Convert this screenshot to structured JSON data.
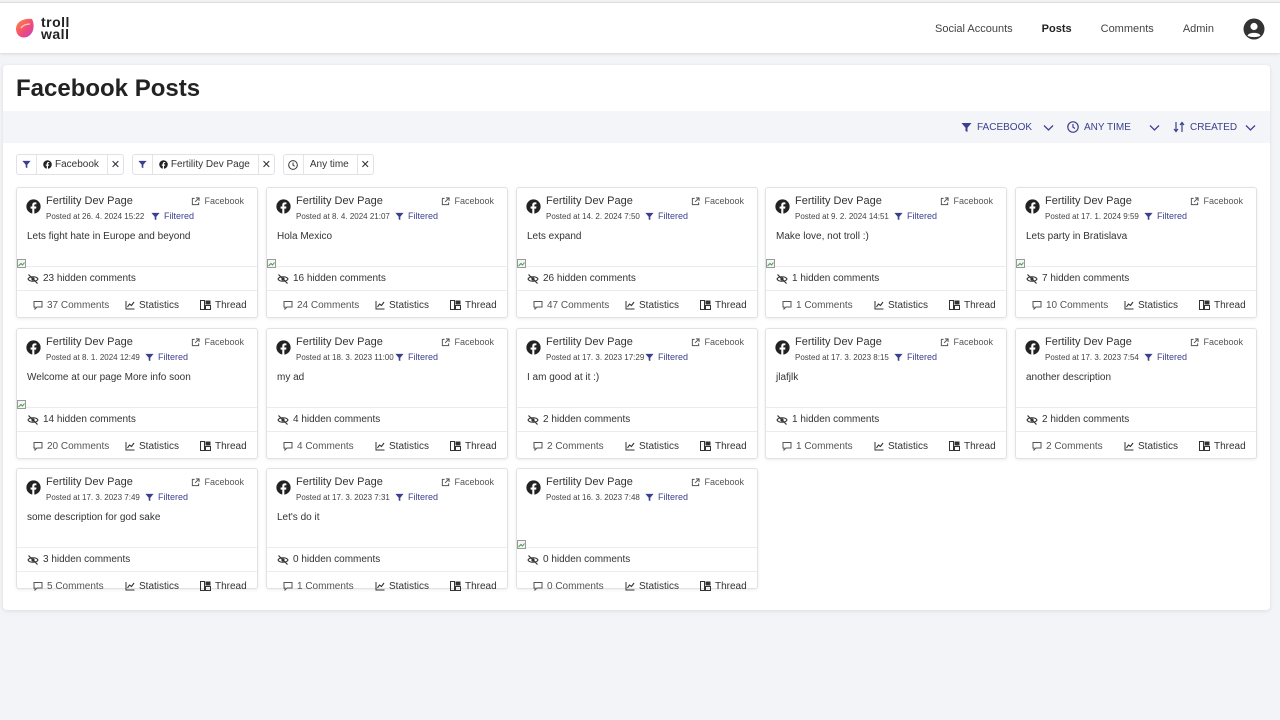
{
  "app": {
    "logo_text": "troll wall"
  },
  "nav": {
    "items": [
      {
        "label": "Social Accounts",
        "active": false
      },
      {
        "label": "Posts",
        "active": true
      },
      {
        "label": "Comments",
        "active": false
      },
      {
        "label": "Admin",
        "active": false
      }
    ]
  },
  "page": {
    "title": "Facebook Posts"
  },
  "filterbar": {
    "platform": "FACEBOOK",
    "time": "ANY TIME",
    "sort": "CREATED"
  },
  "chips": [
    {
      "label": "Facebook",
      "has_fb_icon": true,
      "icon": "filter-icon"
    },
    {
      "label": "Fertility Dev Page",
      "has_fb_icon": true,
      "icon": "filter-icon"
    },
    {
      "label": "Any time",
      "has_fb_icon": false,
      "icon": "clock-icon"
    }
  ],
  "labels": {
    "facebook_link": "Facebook",
    "filtered": "Filtered",
    "statistics": "Statistics",
    "thread": "Thread"
  },
  "accent_color": "#3b3f8f",
  "posts": [
    {
      "page": "Fertility Dev Page",
      "posted": "Posted at 26. 4. 2024 15:22",
      "text": "Lets fight hate in Europe and beyond",
      "hidden": "23 hidden comments",
      "comments": "37 Comments",
      "has_image": true
    },
    {
      "page": "Fertility Dev Page",
      "posted": "Posted at 8. 4. 2024 21:07",
      "text": "Hola Mexico",
      "hidden": "16 hidden comments",
      "comments": "24 Comments",
      "has_image": true
    },
    {
      "page": "Fertility Dev Page",
      "posted": "Posted at 14. 2. 2024 7:50",
      "text": "Lets expand",
      "hidden": "26 hidden comments",
      "comments": "47 Comments",
      "has_image": true
    },
    {
      "page": "Fertility Dev Page",
      "posted": "Posted at 9. 2. 2024 14:51",
      "text": "Make love, not troll :)",
      "hidden": "1 hidden comments",
      "comments": "1 Comments",
      "has_image": true
    },
    {
      "page": "Fertility Dev Page",
      "posted": "Posted at 17. 1. 2024 9:59",
      "text": "Lets party in Bratislava",
      "hidden": "7 hidden comments",
      "comments": "10 Comments",
      "has_image": true
    },
    {
      "page": "Fertility Dev Page",
      "posted": "Posted at 8. 1. 2024 12:49",
      "text": "Welcome at our page More info soon",
      "hidden": "14 hidden comments",
      "comments": "20 Comments",
      "has_image": true
    },
    {
      "page": "Fertility Dev Page",
      "posted": "Posted at 18. 3. 2023 11:00",
      "text": "my ad",
      "hidden": "4 hidden comments",
      "comments": "4 Comments",
      "has_image": false
    },
    {
      "page": "Fertility Dev Page",
      "posted": "Posted at 17. 3. 2023 17:29",
      "text": "I am good at it :)",
      "hidden": "2 hidden comments",
      "comments": "2 Comments",
      "has_image": false
    },
    {
      "page": "Fertility Dev Page",
      "posted": "Posted at 17. 3. 2023 8:15",
      "text": "jlafjlk",
      "hidden": "1 hidden comments",
      "comments": "1 Comments",
      "has_image": false
    },
    {
      "page": "Fertility Dev Page",
      "posted": "Posted at 17. 3. 2023 7:54",
      "text": "another description",
      "hidden": "2 hidden comments",
      "comments": "2 Comments",
      "has_image": false
    },
    {
      "page": "Fertility Dev Page",
      "posted": "Posted at 17. 3. 2023 7:49",
      "text": "some description for god sake",
      "hidden": "3 hidden comments",
      "comments": "5 Comments",
      "has_image": false
    },
    {
      "page": "Fertility Dev Page",
      "posted": "Posted at 17. 3. 2023 7:31",
      "text": "Let's do it",
      "hidden": "0 hidden comments",
      "comments": "1 Comments",
      "has_image": false
    },
    {
      "page": "Fertility Dev Page",
      "posted": "Posted at 16. 3. 2023 7:48",
      "text": "",
      "hidden": "0 hidden comments",
      "comments": "0 Comments",
      "has_image": true
    }
  ]
}
